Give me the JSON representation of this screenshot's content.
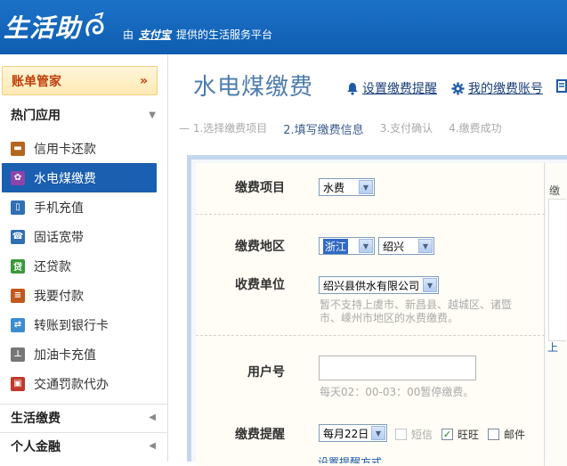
{
  "header": {
    "logo_text": "生活助",
    "slogan_prefix": "由",
    "slogan_brand": "支付宝",
    "slogan_suffix": "提供的生活服务平台"
  },
  "sidebar": {
    "bill_manager": "账单管家",
    "bill_manager_chevron": "»",
    "hot_apps": "热门应用",
    "items": [
      {
        "label": "信用卡还款",
        "icon": "credit-card-icon",
        "color": "#b5651d"
      },
      {
        "label": "水电煤缴费",
        "icon": "utility-icon",
        "color": "#8e44ad"
      },
      {
        "label": "手机充值",
        "icon": "mobile-phone-icon",
        "color": "#2f6fb5"
      },
      {
        "label": "固话宽带",
        "icon": "landline-icon",
        "color": "#2f6fb5"
      },
      {
        "label": "还贷款",
        "icon": "loan-icon",
        "color": "#3a9a3a"
      },
      {
        "label": "我要付款",
        "icon": "payment-icon",
        "color": "#c0581c"
      },
      {
        "label": "转账到银行卡",
        "icon": "bank-transfer-icon",
        "color": "#3c8dd0"
      },
      {
        "label": "加油卡充值",
        "icon": "fuel-card-icon",
        "color": "#777777"
      },
      {
        "label": "交通罚款代办",
        "icon": "traffic-fine-icon",
        "color": "#c0392b"
      }
    ],
    "life_payment": "生活缴费",
    "personal_finance": "个人金融"
  },
  "main": {
    "title": "水电煤缴费",
    "links": {
      "reminder": "设置缴费提醒",
      "my_account": "我的缴费账号"
    },
    "steps": [
      "1.选择缴费项目",
      "2.填写缴费信息",
      "3.支付确认",
      "4.缴费成功"
    ],
    "form": {
      "item_label": "缴费项目",
      "item_value": "水费",
      "region_label": "缴费地区",
      "province_value": "浙江",
      "city_value": "绍兴",
      "unit_label": "收费单位",
      "unit_value": "绍兴县供水有限公司",
      "unit_hint": "暂不支持上虞市、新昌县、越城区、诸暨市、嵊州市地区的水费缴费。",
      "user_label": "用户号",
      "user_value": "",
      "user_hint": "每天02：00-03：00暂停缴费。",
      "remind_label": "缴费提醒",
      "remind_value": "每月22日",
      "sms": "短信",
      "wangwang": "旺旺",
      "email": "邮件",
      "remind_link": "设置提醒方式"
    },
    "side_text": "缴",
    "side_link": "上"
  }
}
